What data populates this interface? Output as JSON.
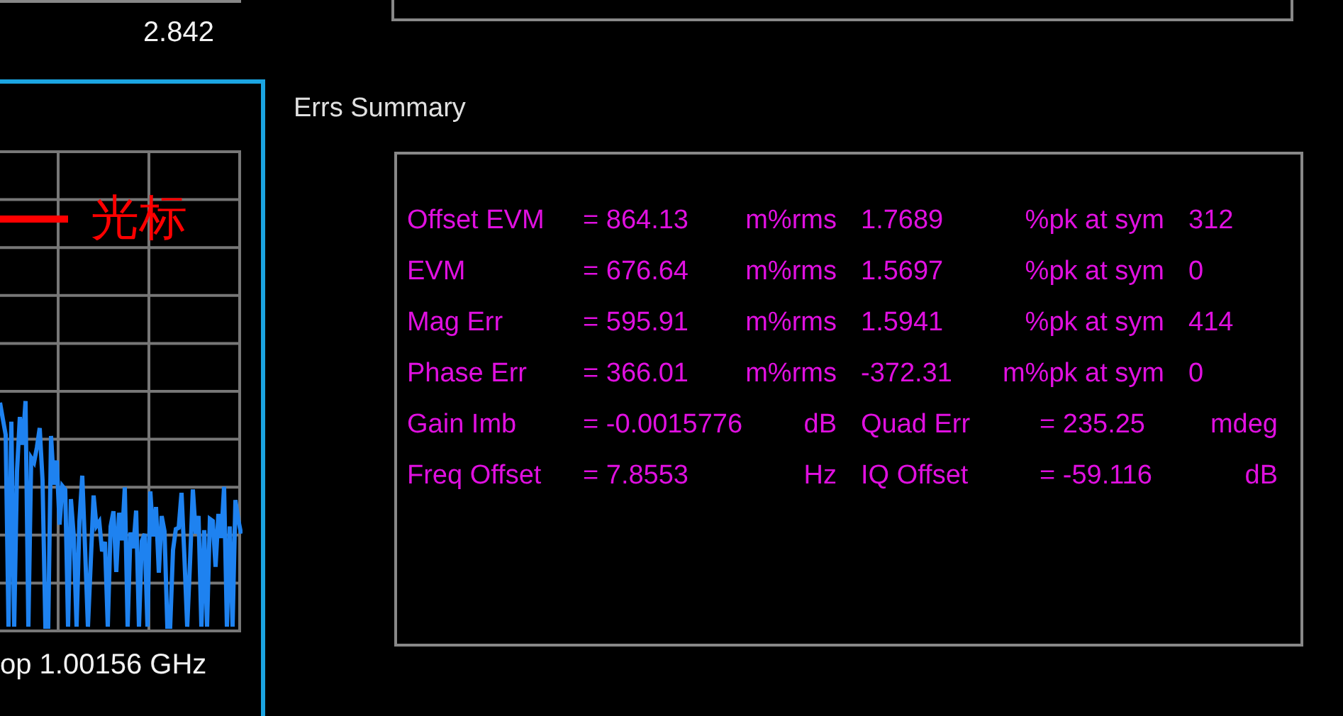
{
  "top_readout": "2.842",
  "trace_panel": {
    "annotation": "光标",
    "footer": "op 1.00156 GHz"
  },
  "errs_summary": {
    "title": "Errs Summary",
    "rows": [
      {
        "kind": "stat",
        "cells": [
          "Offset EVM",
          "= 864.13",
          "m%rms",
          "1.7689",
          "%pk at sym",
          "312"
        ]
      },
      {
        "kind": "stat",
        "cells": [
          "EVM",
          "= 676.64",
          "m%rms",
          "1.5697",
          "%pk at sym",
          "0"
        ]
      },
      {
        "kind": "stat",
        "cells": [
          "Mag Err",
          "= 595.91",
          "m%rms",
          "1.5941",
          "%pk at sym",
          "414"
        ]
      },
      {
        "kind": "stat",
        "cells": [
          "Phase Err",
          "= 366.01",
          "m%rms",
          "-372.31",
          "m%pk at sym",
          "0"
        ]
      },
      {
        "kind": "pair",
        "cells": [
          "Gain Imb",
          "= -0.0015776",
          "dB",
          "Quad Err",
          "= 235.25",
          "mdeg"
        ]
      },
      {
        "kind": "pair",
        "cells": [
          "Freq Offset",
          "= 7.8553",
          "Hz",
          "IQ Offset",
          "= -59.116",
          "dB"
        ]
      }
    ]
  }
}
